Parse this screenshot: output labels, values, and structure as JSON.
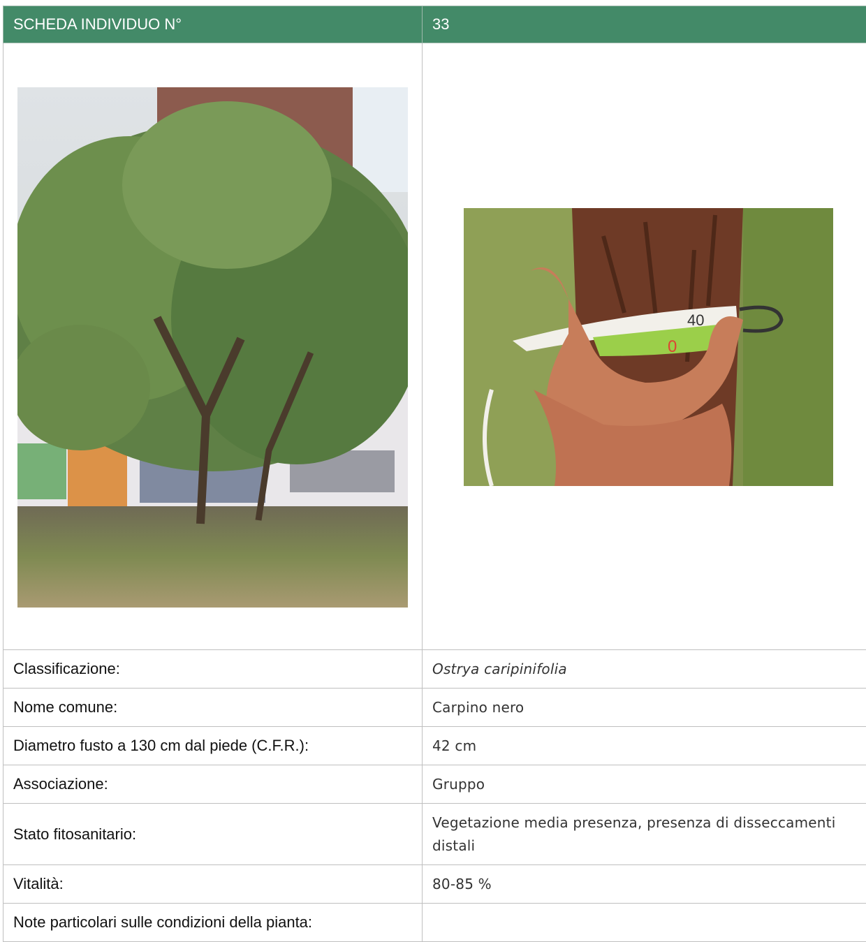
{
  "header": {
    "title": "SCHEDA INDIVIDUO N°",
    "number": "33"
  },
  "photos": {
    "tree": {
      "icon": "tree-photo"
    },
    "trunk": {
      "icon": "trunk-measurement-photo",
      "tape_labels": [
        "40",
        "0"
      ]
    }
  },
  "rows": [
    {
      "label": "Classificazione:",
      "value": "Ostrya caripinifolia"
    },
    {
      "label": "Nome comune:",
      "value": "Carpino nero"
    },
    {
      "label": "Diametro fusto a 130 cm dal piede (C.F.R.):",
      "value": "42 cm"
    },
    {
      "label": "Associazione:",
      "value": "Gruppo"
    },
    {
      "label": "Stato fitosanitario:",
      "value": "Vegetazione media presenza, presenza di disseccamenti distali"
    },
    {
      "label": "Vitalità:",
      "value": "80-85 %"
    },
    {
      "label": "Note particolari sulle condizioni della pianta:",
      "value": ""
    }
  ],
  "colors": {
    "header_bg": "#438a68",
    "border": "#bfbfbf"
  }
}
